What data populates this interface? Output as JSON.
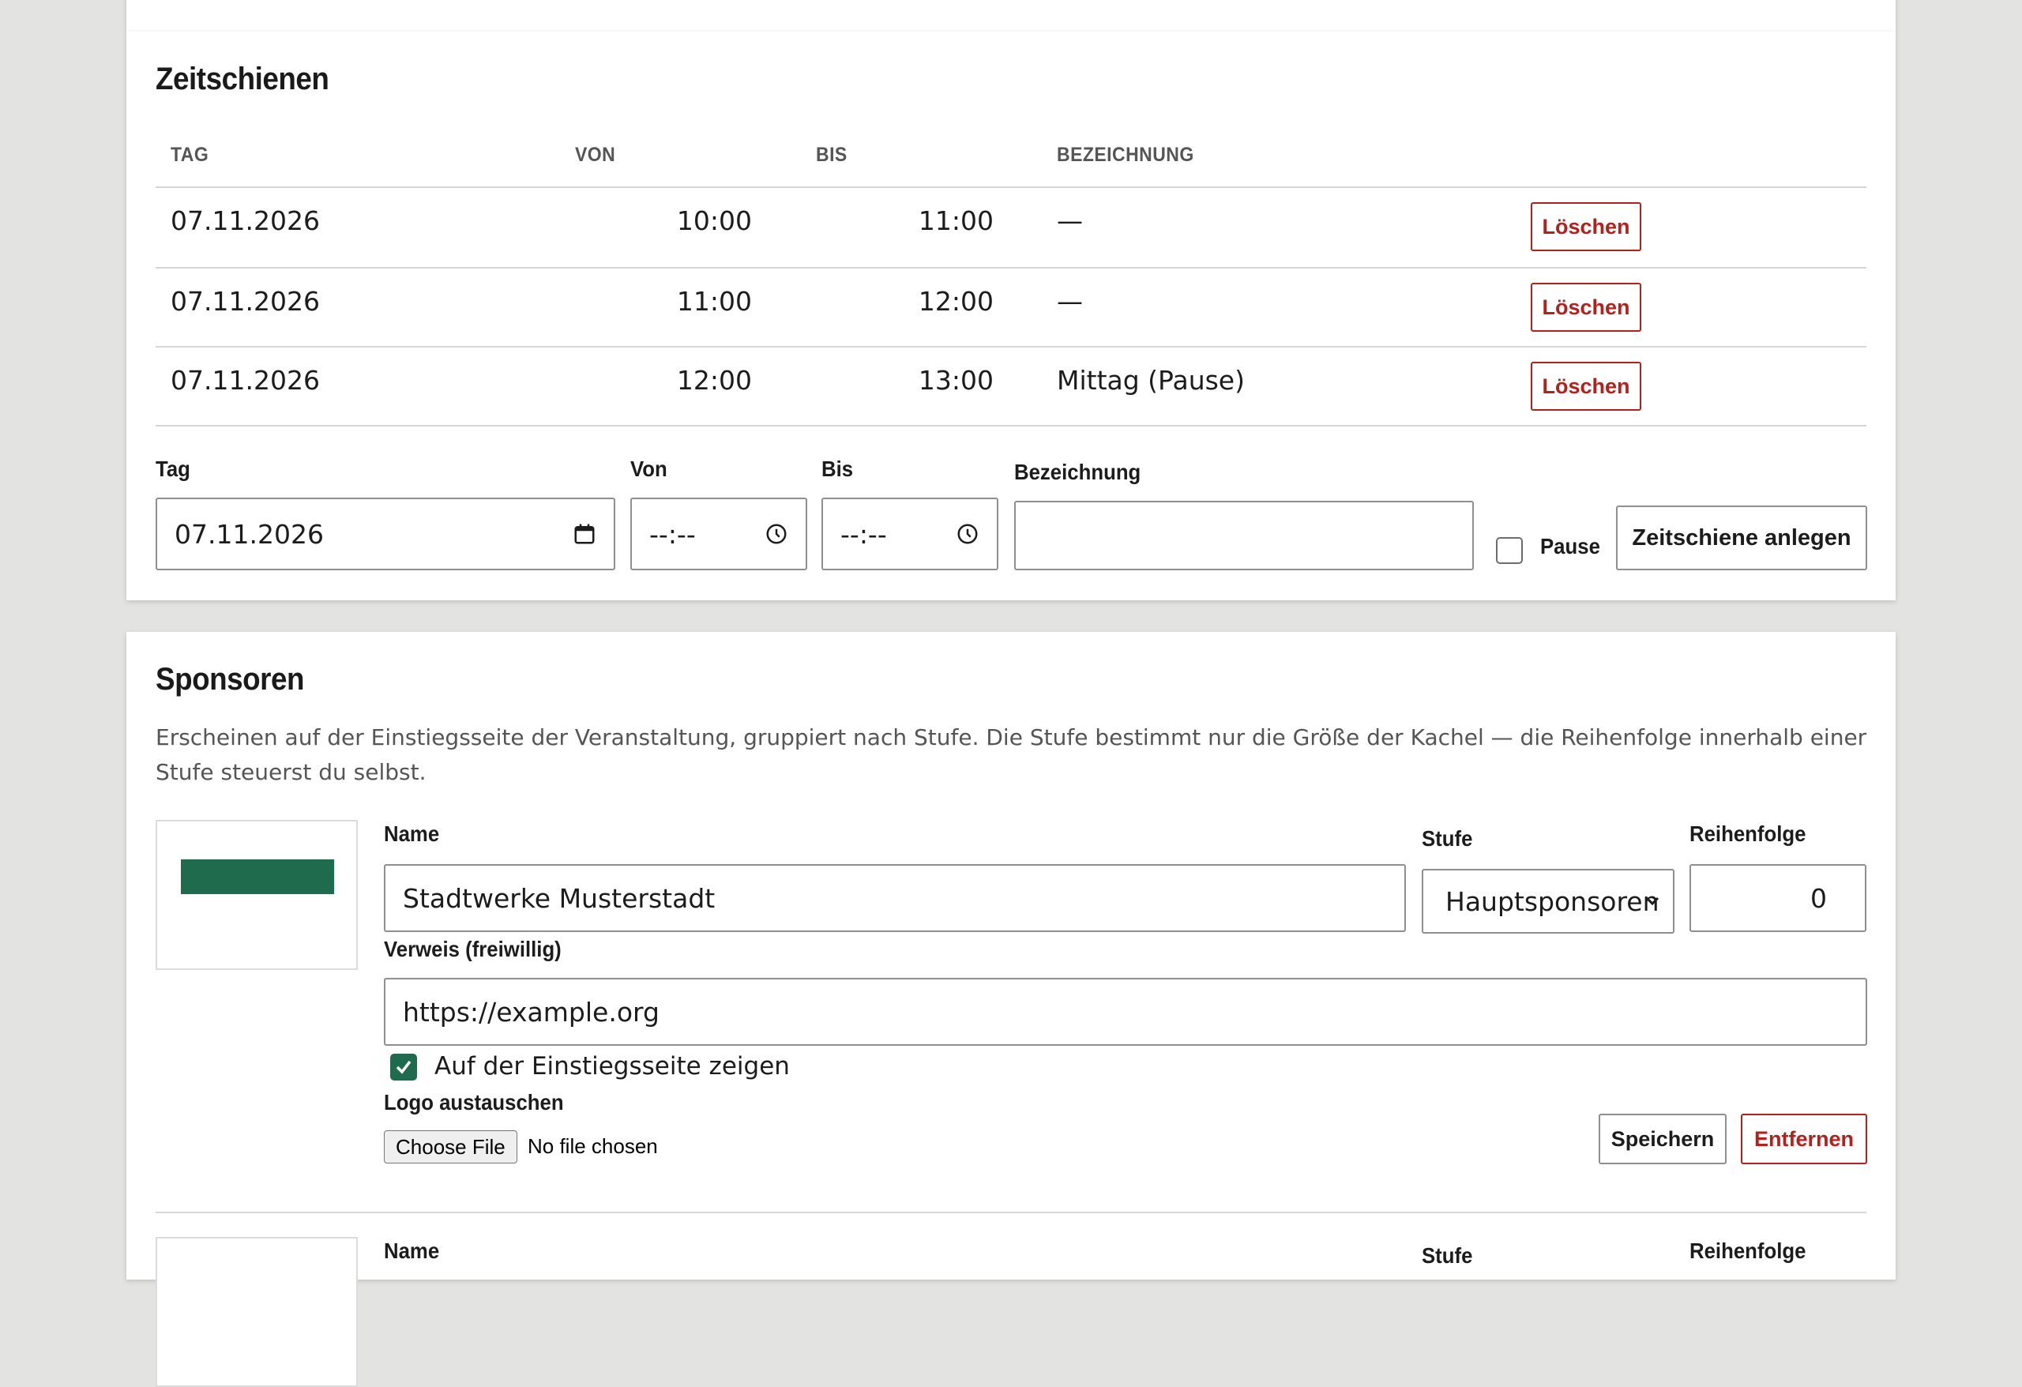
{
  "timeslots": {
    "title": "Zeitschienen",
    "columns": [
      "TAG",
      "VON",
      "BIS",
      "BEZEICHNUNG"
    ],
    "rows": [
      {
        "tag": "07.11.2026",
        "von": "10:00",
        "bis": "11:00",
        "bezeichnung": "—",
        "delete_label": "Löschen"
      },
      {
        "tag": "07.11.2026",
        "von": "11:00",
        "bis": "12:00",
        "bezeichnung": "—",
        "delete_label": "Löschen"
      },
      {
        "tag": "07.11.2026",
        "von": "12:00",
        "bis": "13:00",
        "bezeichnung": "Mittag (Pause)",
        "delete_label": "Löschen"
      }
    ],
    "form": {
      "tag_label": "Tag",
      "tag_value": "07.11.2026",
      "von_label": "Von",
      "von_value": "--:--",
      "bis_label": "Bis",
      "bis_value": "--:--",
      "bezeichnung_label": "Bezeichnung",
      "bezeichnung_value": "",
      "pause_label": "Pause",
      "pause_checked": false,
      "submit_label": "Zeitschiene anlegen"
    }
  },
  "sponsors": {
    "title": "Sponsoren",
    "description": "Erscheinen auf der Einstiegsseite der Veranstaltung, gruppiert nach Stufe. Die Stufe bestimmt nur die Größe der Kachel — die Reihenfolge innerhalb einer Stufe steuerst du selbst.",
    "items": [
      {
        "logo_color": "#1e6b4e",
        "name_label": "Name",
        "name_value": "Stadtwerke Musterstadt",
        "stufe_label": "Stufe",
        "stufe_value": "Hauptsponsoren",
        "reihenfolge_label": "Reihenfolge",
        "reihenfolge_value": "0",
        "verweis_label": "Verweis (freiwillig)",
        "verweis_value": "https://example.org",
        "show_label": "Auf der Einstiegsseite zeigen",
        "show_checked": true,
        "logo_label": "Logo austauschen",
        "file_button": "Choose File",
        "file_status": "No file chosen",
        "save_label": "Speichern",
        "remove_label": "Entfernen"
      },
      {
        "name_label": "Name",
        "stufe_label": "Stufe",
        "reihenfolge_label": "Reihenfolge"
      }
    ]
  },
  "colors": {
    "accent": "#1e6b4e",
    "danger": "#b3211c",
    "background": "#e3e4e2"
  }
}
